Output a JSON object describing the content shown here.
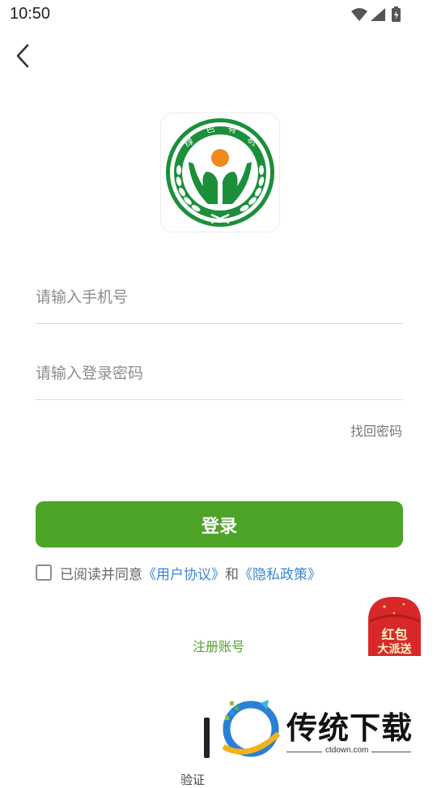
{
  "status_bar": {
    "time": "10:50"
  },
  "logo": {
    "badge_text": "绿色有机",
    "colors": {
      "green": "#1b8f3a",
      "orange": "#f08a1c"
    }
  },
  "form": {
    "phone_placeholder": "请输入手机号",
    "password_placeholder": "请输入登录密码",
    "forgot_label": "找回密码",
    "login_label": "登录"
  },
  "agreement": {
    "prefix": "已阅读并同意",
    "user_agreement": "《用户协议》",
    "and": "和",
    "privacy_policy": "《隐私政策》"
  },
  "register_label": "注册账号",
  "red_packet": {
    "line1": "红包",
    "line2": "大派送"
  },
  "watermark": {
    "title": "传统下载",
    "url": "ctdown.com"
  },
  "bottom_partial_text": "验证",
  "colors": {
    "primary": "#4ea329",
    "link": "#3a85d6",
    "red_packet": "#d8282a"
  }
}
